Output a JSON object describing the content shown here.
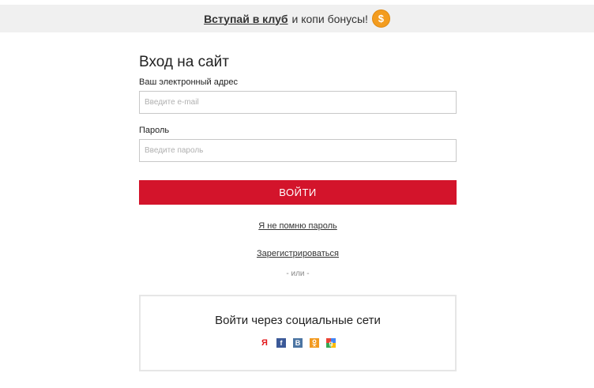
{
  "promo": {
    "link_text": "Вступай в клуб",
    "text": "и копи бонусы!",
    "icon": "coin-icon"
  },
  "login": {
    "title": "Вход на сайт",
    "email_label": "Ваш электронный адрес",
    "email_placeholder": "Введите e-mail",
    "password_label": "Пароль",
    "password_placeholder": "Введите пароль",
    "submit_label": "ВОЙТИ",
    "forgot_link": "Я не помню пароль",
    "register_link": "Зарегистрироваться",
    "or_text": "- или -"
  },
  "social": {
    "title": "Войти через социальные сети",
    "providers": [
      {
        "name": "yandex-icon",
        "glyph": "Я",
        "color": "#e3171b"
      },
      {
        "name": "facebook-icon",
        "glyph": "f",
        "color": "#3b5998"
      },
      {
        "name": "vk-icon",
        "glyph": "B",
        "color": "#4c75a3"
      },
      {
        "name": "odnoklassniki-icon",
        "glyph": "ok",
        "color": "#f39a1f"
      },
      {
        "name": "google-icon",
        "glyph": "",
        "color": "#4285f4"
      }
    ]
  }
}
